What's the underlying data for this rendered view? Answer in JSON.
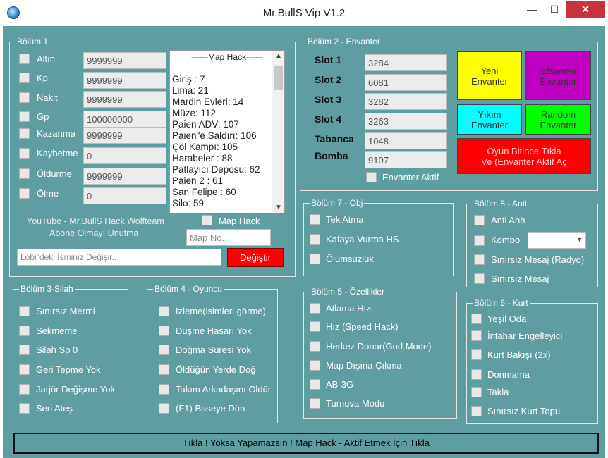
{
  "window": {
    "title": "Mr.BullS Vip V1.2",
    "min": "—",
    "max": "☐",
    "close": "✕"
  },
  "bolum1": {
    "legend": "Bölüm 1",
    "rows": [
      {
        "label": "Altın",
        "value": "9999999"
      },
      {
        "label": "Kp",
        "value": "9999999"
      },
      {
        "label": "Nakit",
        "value": "9999999"
      },
      {
        "label": "Gp",
        "value": "100000000"
      },
      {
        "label": "Kazanma",
        "value": "9999999"
      },
      {
        "label": "Kaybetme",
        "value": "0"
      },
      {
        "label": "Öldürme",
        "value": "9999999"
      },
      {
        "label": "Ölme",
        "value": "0"
      }
    ],
    "map_title": "------Map Hack------",
    "maps": [
      "Giriş : 7",
      "Lima: 21",
      "Mardin Evleri: 14",
      "Müze: 112",
      "Paien ADV: 107",
      "Paien\"e Saldırı: 106",
      "Çöl Kampı: 105",
      "Harabeler : 88",
      "Patlayıcı Deposu: 62",
      "Paien 2 : 61",
      "San Felipe : 60",
      "Silo: 59"
    ],
    "youtube_line1": "YouTube - Mr.BullS Hack Wolfteam",
    "youtube_line2": "Abone Olmayı Unutma",
    "map_hack_label": "Map Hack",
    "map_no_placeholder": "Map No..",
    "lobby_placeholder": "Lobi\"deki İsminiz Değişir..",
    "change_button": "Değiştir"
  },
  "bolum2": {
    "legend": "Bölüm 2 - Envanter",
    "slots": [
      {
        "label": "Slot 1",
        "value": "3284"
      },
      {
        "label": "Slot 2",
        "value": "6081"
      },
      {
        "label": "Slot 3",
        "value": "3282"
      },
      {
        "label": "Slot 4",
        "value": "3263"
      },
      {
        "label": "Tabanca",
        "value": "1048"
      },
      {
        "label": "Bomba",
        "value": "9107"
      }
    ],
    "active_label": "Envanter Aktif",
    "btn_new": [
      "Yeni",
      "Envanter"
    ],
    "btn_legend": [
      "Efsanevi",
      "Envanter"
    ],
    "btn_destroy": [
      "Yıkım",
      "Envanter"
    ],
    "btn_random": [
      "Random",
      "Envanter"
    ],
    "btn_end": [
      "Oyun Bitince Tıkla",
      "Ve (Envanter Aktif Aç"
    ]
  },
  "bolum7": {
    "legend": "Bölüm 7 - Obj",
    "items": [
      "Tek Atma",
      "Kafaya Vurma HS",
      "Ölümsüzlük"
    ]
  },
  "bolum8": {
    "legend": "Bölüm 8 - Anti",
    "items": [
      "Anti Ahh",
      "Kombo",
      "Sınırsız Mesaj (Radyo)",
      "Sınırsız Mesaj"
    ]
  },
  "bolum3": {
    "legend": "Bölüm 3-Silah",
    "items": [
      "Sınırsız Mermi",
      "Sekmeme",
      "Silah Sp 0",
      "Geri Tepme Yok",
      "Jarjör Değişme Yok",
      "Seri Ateş"
    ]
  },
  "bolum4": {
    "legend": "Bölüm 4 - Oyuncu",
    "items": [
      "İzleme(isimleri görme)",
      "Düşme Hasarı Yok",
      "Doğma Süresi Yok",
      "Öldüğün Yerde Doğ",
      "Takım Arkadaşını Öldür",
      "(F1) Baseye Dön"
    ]
  },
  "bolum5": {
    "legend": "Bölüm 5 - Özellikler",
    "items": [
      "Atlama Hızı",
      "Hız (Speed Hack)",
      "Herkez Donar(God Mode)",
      "Map Dışına Çıkma",
      "AB-3G",
      "Turnuva Modu"
    ]
  },
  "bolum6": {
    "legend": "Bölüm 6 - Kurt",
    "items": [
      "Yeşil Oda",
      "İntahar Engelleyici",
      "Kurt Bakışı (2x)",
      "Donmama",
      "Takla",
      "Sınırsız Kurt Topu"
    ]
  },
  "bottom_button": "Tıkla ! Yoksa  Yapamazsın ! Map Hack - Aktif Etmek İçin Tıkla",
  "colors": {
    "background": "#5f9ea0",
    "yellow": "#ffff00",
    "magenta": "#c000c0",
    "cyan": "#00ffff",
    "green": "#00ff00",
    "red": "#ff0000"
  }
}
